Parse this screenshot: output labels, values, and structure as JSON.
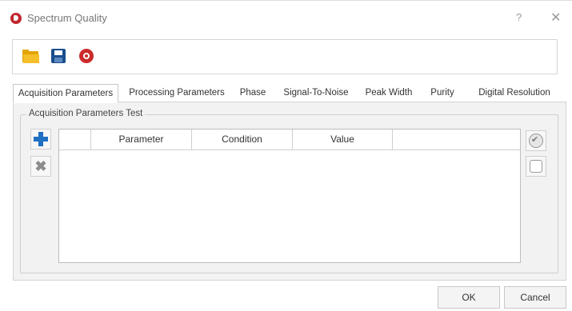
{
  "window": {
    "title": "Spectrum Quality",
    "help_label": "?",
    "close_label": "✕"
  },
  "toolbar": {
    "icons": [
      "folder-icon",
      "save-icon",
      "settings-icon"
    ],
    "colors": {
      "folder": "#f5bf2a",
      "save": "#1a4e8e",
      "settings": "#cc2a2a"
    }
  },
  "tabs": [
    {
      "label": "Acquisition Parameters",
      "active": true
    },
    {
      "label": "Processing Parameters",
      "active": false
    },
    {
      "label": "Phase",
      "active": false
    },
    {
      "label": "Signal-To-Noise",
      "active": false
    },
    {
      "label": "Peak Width",
      "active": false
    },
    {
      "label": "Purity",
      "active": false
    },
    {
      "label": "Digital Resolution",
      "active": false
    }
  ],
  "group": {
    "title": "Acquisition Parameters Test"
  },
  "table": {
    "columns": [
      "",
      "Parameter",
      "Condition",
      "Value",
      ""
    ],
    "rows": []
  },
  "side_buttons": {
    "add_icon": "plus-icon",
    "remove_icon": "x-icon",
    "check_all_icon": "check-all-icon",
    "uncheck_all_icon": "uncheck-all-icon"
  },
  "footer": {
    "ok_label": "OK",
    "cancel_label": "Cancel"
  }
}
